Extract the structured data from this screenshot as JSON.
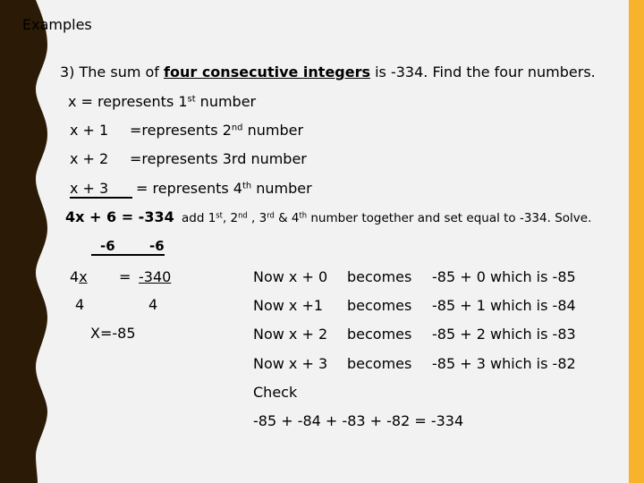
{
  "slide": {
    "title": "Examples",
    "problem": {
      "prefix": "3) The sum of ",
      "emphasis": "four consecutive integers",
      "suffix": " is -334.  Find the four numbers."
    },
    "definitions": [
      {
        "expr": "x = represents 1",
        "sup": "st",
        "rest": " number"
      },
      {
        "expr": "x + 1",
        "label": "=represents 2",
        "sup": "nd",
        "rest": " number"
      },
      {
        "expr": "x + 2",
        "label": "=represents 3rd number"
      },
      {
        "expr": "x + 3",
        "label": "=  represents 4",
        "sup": "th",
        "rest": " number"
      }
    ],
    "equation": {
      "main": "4x + 6 = -334",
      "note_parts": [
        "add 1",
        "st",
        ", 2",
        "nd",
        " , 3",
        "rd",
        " & 4",
        "th",
        " number together and set equal to -334.  Solve."
      ],
      "subtract_left": "-6",
      "subtract_right": "-6",
      "step_left": "4x",
      "step_eq": "=",
      "step_right": "-340",
      "divisor_left": "4",
      "divisor_right": "4",
      "result": "X=-85"
    },
    "substitutions": [
      {
        "now": "Now x + 0",
        "becomes": "becomes",
        "calc": "-85 + 0  which is -85"
      },
      {
        "now": "Now x +1",
        "becomes": "becomes",
        "calc": "-85 + 1  which is -84"
      },
      {
        "now": "Now x + 2",
        "becomes": "becomes",
        "calc": "-85 + 2  which is -83"
      },
      {
        "now": "Now x + 3",
        "becomes": "becomes",
        "calc": "-85 + 3  which is -82"
      }
    ],
    "check": {
      "label": "Check",
      "expression": "-85 + -84  + -83 + -82  = -334"
    }
  },
  "colors": {
    "background": "#f2f2f2",
    "left_border": "#2b1a05",
    "right_bar": "#f7b32b",
    "text": "#000000"
  }
}
